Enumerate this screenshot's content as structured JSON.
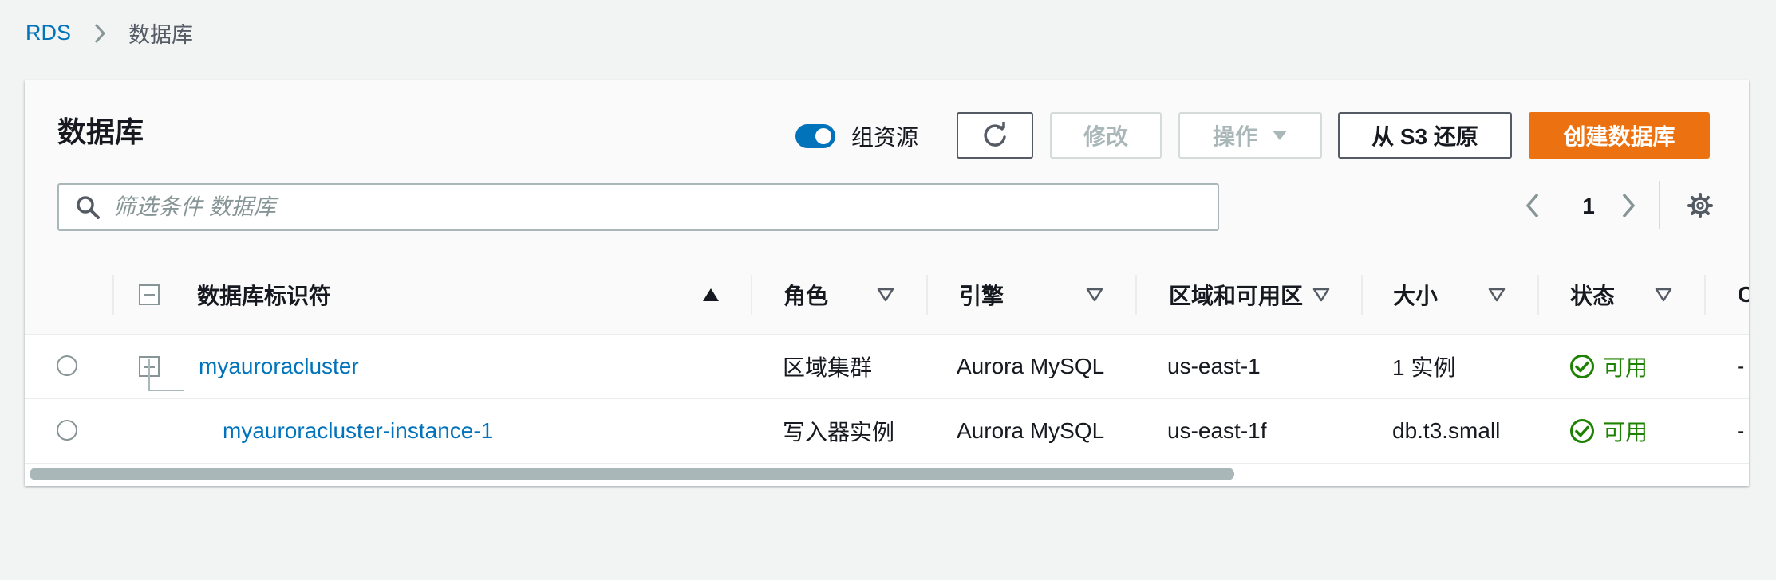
{
  "breadcrumb": {
    "root": "RDS",
    "current": "数据库"
  },
  "panel": {
    "title": "数据库"
  },
  "toolbar": {
    "group_resources_label": "组资源",
    "group_resources_on": true,
    "modify_label": "修改",
    "actions_label": "操作",
    "restore_label": "从 S3 还原",
    "create_label": "创建数据库"
  },
  "search": {
    "placeholder": "筛选条件 数据库"
  },
  "pagination": {
    "current_page": "1"
  },
  "table": {
    "columns": {
      "identifier": "数据库标识符",
      "role": "角色",
      "engine": "引擎",
      "region_az": "区域和可用区",
      "size": "大小",
      "status": "状态",
      "cpu": "CPU"
    },
    "rows": [
      {
        "identifier": "myauroracluster",
        "role": "区域集群",
        "engine": "Aurora MySQL",
        "region_az": "us-east-1",
        "size": "1 实例",
        "status": "可用",
        "cpu": "-"
      },
      {
        "identifier": "myauroracluster-instance-1",
        "role": "写入器实例",
        "engine": "Aurora MySQL",
        "region_az": "us-east-1f",
        "size": "db.t3.small",
        "status": "可用",
        "cpu": "-"
      }
    ]
  },
  "colors": {
    "link": "#0073bb",
    "primary_button": "#ec7211",
    "status_available": "#1d8102",
    "toggle_on": "#0073bb"
  },
  "icons": {
    "breadcrumb_separator": "chevron-right-icon",
    "refresh": "refresh-icon",
    "actions_caret": "caret-down-icon",
    "search": "search-icon",
    "pager_prev": "chevron-left-icon",
    "pager_next": "chevron-right-icon",
    "preferences": "gear-icon",
    "status_ok": "check-circle-icon"
  }
}
